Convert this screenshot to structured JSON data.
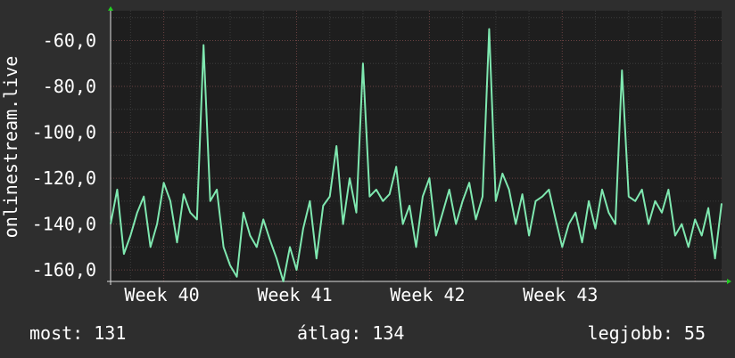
{
  "chart_data": {
    "type": "line",
    "ylabel": "onlinestream.live",
    "ylim": [
      -165,
      -47
    ],
    "yticks": [
      "-60,0",
      "-80,0",
      "-100,0",
      "-120,0",
      "-140,0",
      "-160,0"
    ],
    "ytick_values": [
      -60,
      -80,
      -100,
      -120,
      -140,
      -160
    ],
    "xticks": [
      "Week 40",
      "Week 41",
      "Week 42",
      "Week 43"
    ],
    "xtick_positions": [
      40,
      41,
      42,
      43
    ],
    "xlim": [
      39.6,
      44.2
    ],
    "grid": true,
    "series": [
      {
        "color": "#7fe8b0",
        "x": [
          39.6,
          39.65,
          39.7,
          39.75,
          39.8,
          39.85,
          39.9,
          39.95,
          40.0,
          40.05,
          40.1,
          40.15,
          40.2,
          40.25,
          40.3,
          40.35,
          40.4,
          40.45,
          40.5,
          40.55,
          40.6,
          40.65,
          40.7,
          40.75,
          40.8,
          40.85,
          40.9,
          40.95,
          41.0,
          41.05,
          41.1,
          41.15,
          41.2,
          41.25,
          41.3,
          41.35,
          41.4,
          41.45,
          41.5,
          41.55,
          41.6,
          41.65,
          41.7,
          41.75,
          41.8,
          41.85,
          41.9,
          41.95,
          42.0,
          42.05,
          42.1,
          42.15,
          42.2,
          42.25,
          42.3,
          42.35,
          42.4,
          42.45,
          42.5,
          42.55,
          42.6,
          42.65,
          42.7,
          42.75,
          42.8,
          42.85,
          42.9,
          42.95,
          43.0,
          43.05,
          43.1,
          43.15,
          43.2,
          43.25,
          43.3,
          43.35,
          43.4,
          43.45,
          43.5,
          43.55,
          43.6,
          43.65,
          43.7,
          43.75,
          43.8,
          43.85,
          43.9,
          43.95,
          44.0,
          44.05,
          44.1,
          44.15,
          44.2
        ],
        "values": [
          -140,
          -125,
          -153,
          -145,
          -135,
          -128,
          -150,
          -140,
          -122,
          -130,
          -148,
          -127,
          -135,
          -138,
          -62,
          -130,
          -125,
          -150,
          -158,
          -163,
          -135,
          -145,
          -150,
          -138,
          -147,
          -155,
          -165,
          -150,
          -160,
          -142,
          -130,
          -155,
          -132,
          -128,
          -106,
          -140,
          -120,
          -135,
          -70,
          -128,
          -125,
          -130,
          -127,
          -115,
          -140,
          -132,
          -150,
          -128,
          -120,
          -145,
          -135,
          -125,
          -140,
          -130,
          -122,
          -138,
          -128,
          -55,
          -130,
          -118,
          -125,
          -140,
          -127,
          -145,
          -130,
          -128,
          -125,
          -138,
          -150,
          -140,
          -135,
          -148,
          -130,
          -142,
          -125,
          -135,
          -140,
          -73,
          -128,
          -130,
          -125,
          -140,
          -130,
          -135,
          -125,
          -145,
          -140,
          -150,
          -138,
          -145,
          -133,
          -155,
          -131
        ]
      }
    ]
  },
  "footer": {
    "now": "most: 131",
    "avg": "átlag: 134",
    "best": "legjobb: 55"
  }
}
